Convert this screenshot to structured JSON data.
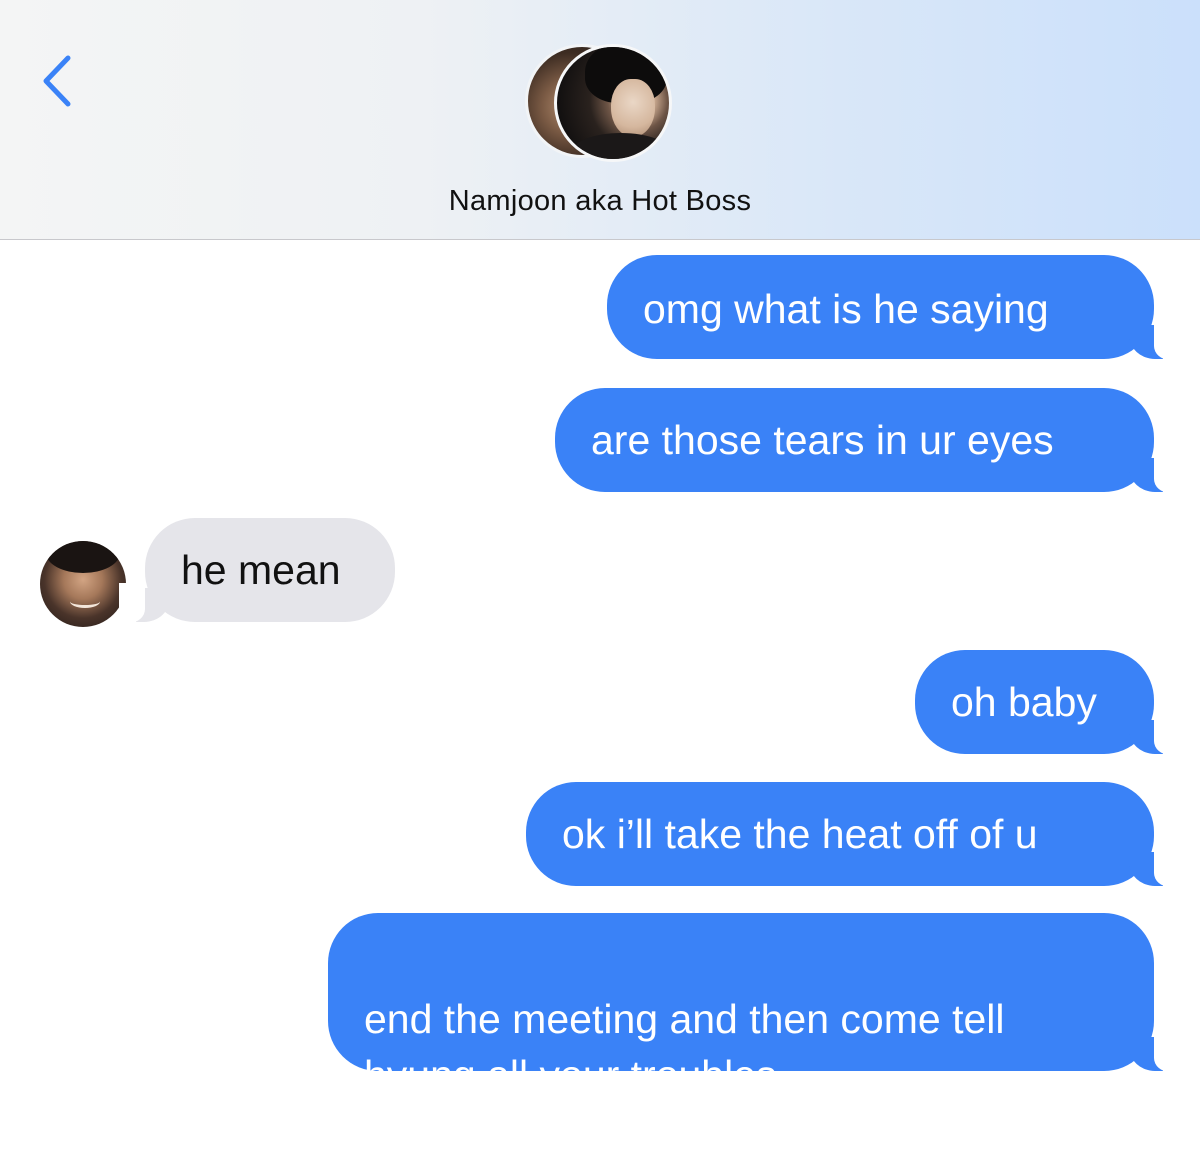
{
  "header": {
    "back_icon": "chevron-left-icon",
    "contact_name": "Namjoon aka Hot Boss",
    "accent_color": "#3a82f7"
  },
  "messages": [
    {
      "side": "sent",
      "text": "omg what is he saying"
    },
    {
      "side": "sent",
      "text": "are those tears in ur eyes"
    },
    {
      "side": "received",
      "text": "he mean"
    },
    {
      "side": "sent",
      "text": "oh baby"
    },
    {
      "side": "sent",
      "text": "ok i’ll take the heat off of u"
    },
    {
      "side": "sent",
      "text": "end the meeting and then come tell\nhyung all your troubles"
    }
  ],
  "colors": {
    "sent_bubble": "#3a82f7",
    "received_bubble": "#e5e5ea"
  }
}
